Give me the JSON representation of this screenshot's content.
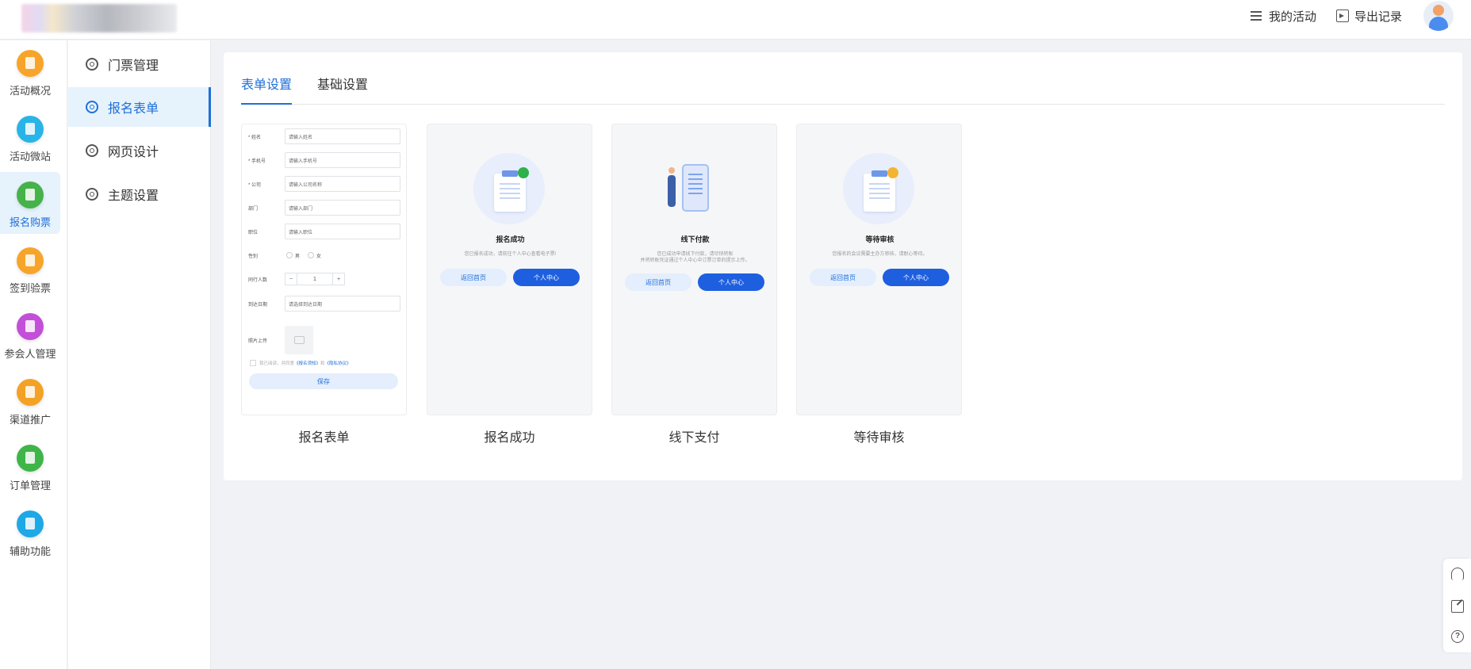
{
  "header": {
    "my_activities": "我的活动",
    "export_records": "导出记录"
  },
  "iconbar": {
    "items": [
      {
        "label": "活动概况",
        "color": "#f7a52a"
      },
      {
        "label": "活动微站",
        "color": "#29b4e8"
      },
      {
        "label": "报名购票",
        "color": "#46b24a"
      },
      {
        "label": "签到验票",
        "color": "#f7a52a"
      },
      {
        "label": "参会人管理",
        "color": "#c34fd8"
      },
      {
        "label": "渠道推广",
        "color": "#f4a225"
      },
      {
        "label": "订单管理",
        "color": "#3eb548"
      },
      {
        "label": "辅助功能",
        "color": "#1fa8e6"
      }
    ],
    "active_index": 2
  },
  "submenu": {
    "items": [
      {
        "label": "门票管理"
      },
      {
        "label": "报名表单"
      },
      {
        "label": "网页设计"
      },
      {
        "label": "主题设置"
      }
    ],
    "active_index": 1
  },
  "tabs": [
    {
      "label": "表单设置"
    },
    {
      "label": "基础设置"
    }
  ],
  "cards": {
    "form": {
      "caption": "报名表单",
      "fields": [
        {
          "label": "* 姓名",
          "placeholder": "请输入姓名"
        },
        {
          "label": "* 手机号",
          "placeholder": "请输入手机号"
        },
        {
          "label": "* 公司",
          "placeholder": "请输入公司名称"
        },
        {
          "label": "部门",
          "placeholder": "请输入部门"
        },
        {
          "label": "职位",
          "placeholder": "请输入职位"
        }
      ],
      "gender_label": "性别",
      "gender_male": "男",
      "gender_female": "女",
      "companions_label": "同行人数",
      "stepper_minus": "−",
      "stepper_value": "1",
      "stepper_plus": "+",
      "arrival_label": "到达日期",
      "arrival_placeholder": "请选择到达日期",
      "photo_label": "照片上传",
      "agree_text": "我已阅读，并同意",
      "agree_link1": "《报名须知》",
      "agree_and": "和",
      "agree_link2": "《隐私协议》",
      "save": "保存"
    },
    "success": {
      "caption": "报名成功",
      "title": "报名成功",
      "desc1": "您已报名成功，请前往个人中心查看电子票!",
      "desc2": "",
      "btn_home": "返回首页",
      "btn_center": "个人中心"
    },
    "offline": {
      "caption": "线下支付",
      "title": "线下付款",
      "desc1": "您已成功申请线下付款，请尽快转账",
      "desc2": "并将转账凭证通过个人中心中订票订单的提示上传。",
      "btn_home": "返回首页",
      "btn_center": "个人中心"
    },
    "pending": {
      "caption": "等待审核",
      "title": "等待审核",
      "desc1": "您报名的会议需要主办方审核，请耐心等待。",
      "desc2": "",
      "btn_home": "返回首页",
      "btn_center": "个人中心"
    }
  }
}
